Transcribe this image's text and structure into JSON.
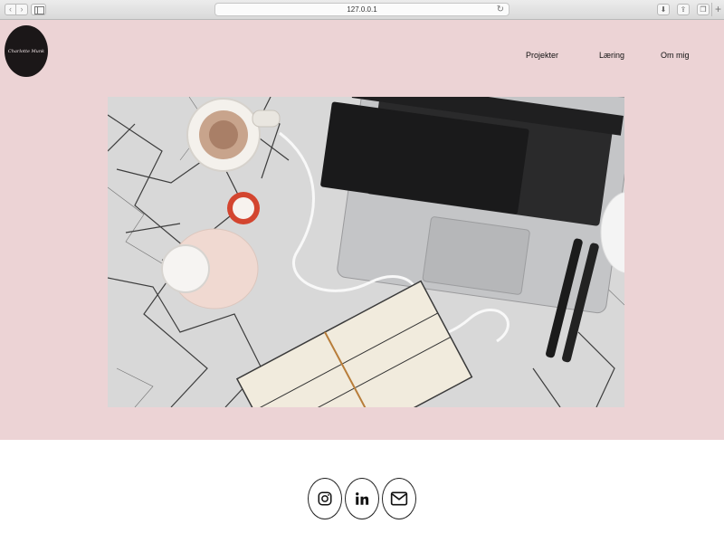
{
  "browser": {
    "back_icon": "back-chevron",
    "forward_icon": "forward-chevron",
    "url": "127.0.0.1",
    "reload_icon": "reload-icon"
  },
  "header": {
    "logo_text": "Charlotte Munk",
    "nav": [
      {
        "label": "Projekter"
      },
      {
        "label": "Læring"
      },
      {
        "label": "Om mig"
      }
    ]
  },
  "hero": {
    "background_color": "#ecd3d5",
    "image": {
      "desc_items": [
        "laptop",
        "coffee-cup",
        "earbuds",
        "water-bottle",
        "notebook",
        "pens",
        "marble-surface"
      ]
    }
  },
  "footer": {
    "social": [
      {
        "name": "instagram-icon"
      },
      {
        "name": "linkedin-icon"
      },
      {
        "name": "mail-icon"
      }
    ]
  }
}
